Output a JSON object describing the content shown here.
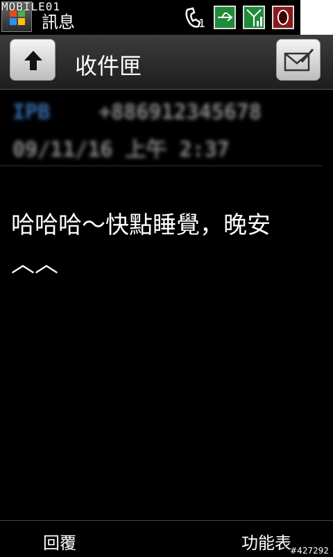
{
  "status_bar": {
    "logo_text": "MOBILE01",
    "app_title": "訊息",
    "missed_calls": "1",
    "icons": [
      "start-flag-icon",
      "phone-icon",
      "usb-icon",
      "signal-icon",
      "speaker-icon"
    ]
  },
  "header": {
    "title": "收件匣",
    "back_icon": "arrow-up-icon",
    "compose_icon": "envelope-compose-icon"
  },
  "message": {
    "sender_name": "IPB",
    "sender_number": "+886912345678",
    "timestamp": "09/11/16 上午 2:37",
    "body": "哈哈哈～快點睡覺，晚安︿︿"
  },
  "bottom_bar": {
    "left_soft_key": "回覆",
    "right_soft_key": "功能表"
  },
  "watermark_id": "#427292"
}
